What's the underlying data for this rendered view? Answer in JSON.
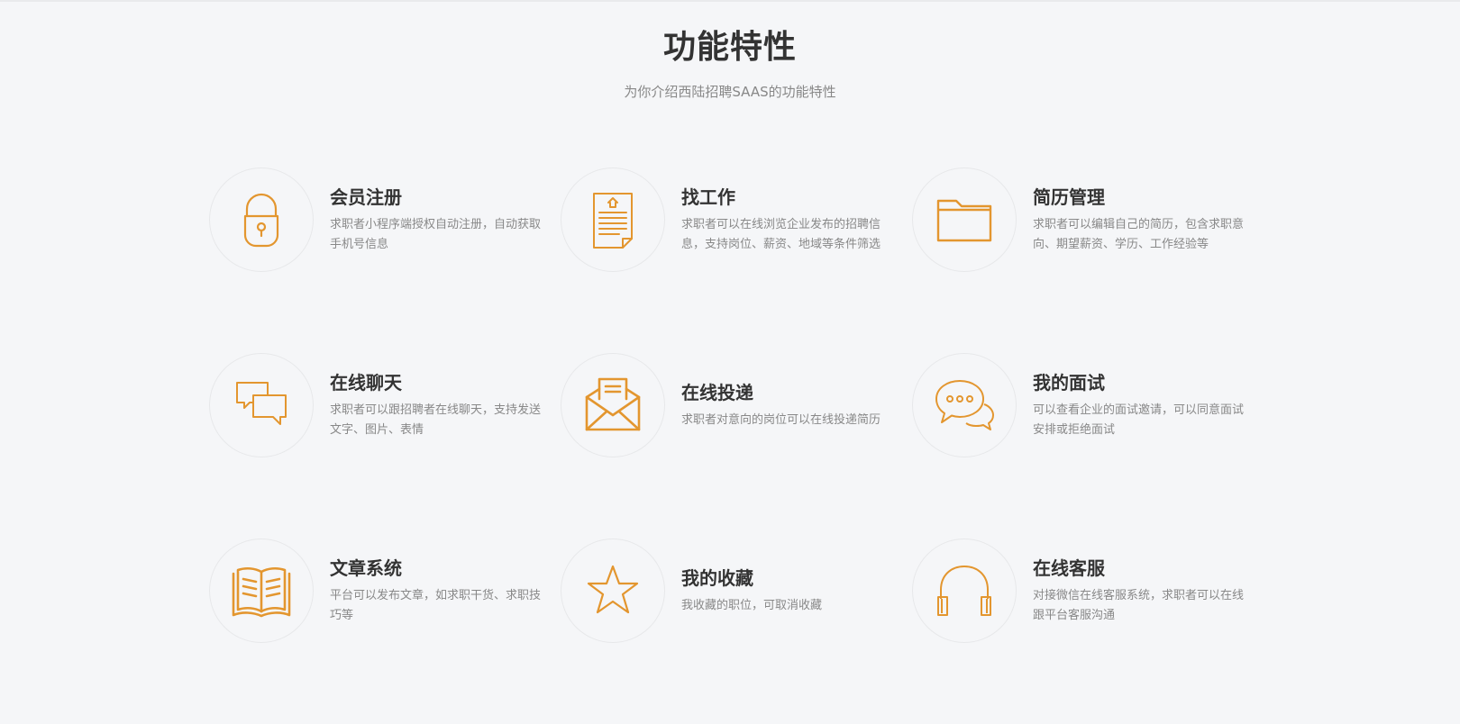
{
  "header": {
    "title": "功能特性",
    "subtitle": "为你介绍西陆招聘SAAS的功能特性"
  },
  "accent_color": "#e3962f",
  "features": [
    {
      "icon": "lock-icon",
      "title": "会员注册",
      "desc": "求职者小程序端授权自动注册，自动获取手机号信息"
    },
    {
      "icon": "document-icon",
      "title": "找工作",
      "desc": "求职者可以在线浏览企业发布的招聘信息，支持岗位、薪资、地域等条件筛选"
    },
    {
      "icon": "folder-icon",
      "title": "简历管理",
      "desc": "求职者可以编辑自己的简历，包含求职意向、期望薪资、学历、工作经验等"
    },
    {
      "icon": "chat-bubbles-icon",
      "title": "在线聊天",
      "desc": "求职者可以跟招聘者在线聊天，支持发送文字、图片、表情"
    },
    {
      "icon": "envelope-icon",
      "title": "在线投递",
      "desc": "求职者对意向的岗位可以在线投递简历"
    },
    {
      "icon": "speech-bubble-icon",
      "title": "我的面试",
      "desc": "可以查看企业的面试邀请，可以同意面试安排或拒绝面试"
    },
    {
      "icon": "book-icon",
      "title": "文章系统",
      "desc": "平台可以发布文章，如求职干货、求职技巧等"
    },
    {
      "icon": "star-icon",
      "title": "我的收藏",
      "desc": "我收藏的职位，可取消收藏"
    },
    {
      "icon": "headphones-icon",
      "title": "在线客服",
      "desc": "对接微信在线客服系统，求职者可以在线跟平台客服沟通"
    }
  ]
}
